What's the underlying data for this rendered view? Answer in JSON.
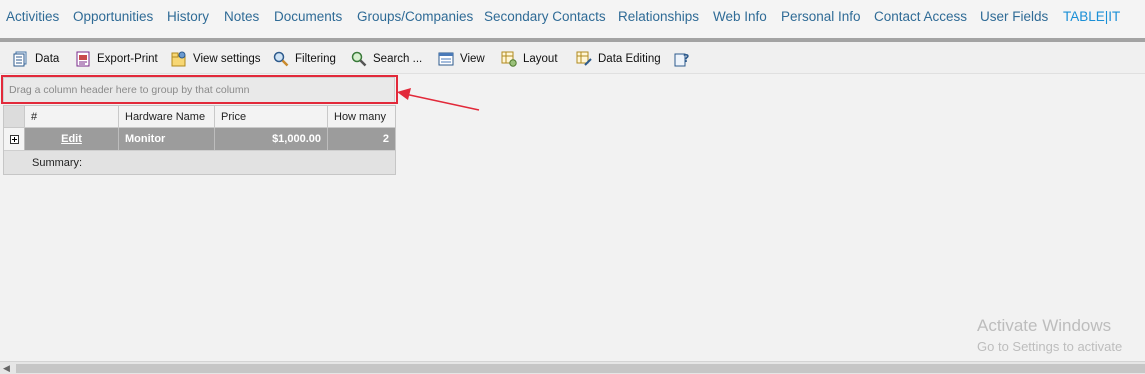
{
  "nav": {
    "items": [
      {
        "label": "Activities"
      },
      {
        "label": "Opportunities"
      },
      {
        "label": "History"
      },
      {
        "label": "Notes"
      },
      {
        "label": "Documents"
      },
      {
        "label": "Groups/Companies"
      },
      {
        "label": "Secondary Contacts"
      },
      {
        "label": "Relationships"
      },
      {
        "label": "Web Info"
      },
      {
        "label": "Personal Info"
      },
      {
        "label": "Contact Access"
      },
      {
        "label": "User Fields"
      },
      {
        "label": "TABLE|IT"
      }
    ],
    "active_tab": "TABLE|IT"
  },
  "toolbar": {
    "data": "Data",
    "export_print": "Export-Print",
    "view_settings": "View settings",
    "filtering": "Filtering",
    "search": "Search ...",
    "view": "View",
    "layout": "Layout",
    "data_editing": "Data Editing",
    "help_icon": "help-icon"
  },
  "grid": {
    "group_panel_text": "Drag a column header here to group by that column",
    "columns": [
      "#",
      "Hardware Name",
      "Price",
      "How many"
    ],
    "rows": [
      {
        "edit": "Edit",
        "hardware_name": "Monitor",
        "price": "$1,000.00",
        "how_many": "2"
      }
    ],
    "summary_label": "Summary:"
  },
  "watermark": {
    "line1": "Activate Windows",
    "line2": "Go to Settings to activate"
  },
  "colors": {
    "highlight": "#e2293a",
    "nav_link": "#2f6b96",
    "selected_row": "#9c9c9c"
  }
}
